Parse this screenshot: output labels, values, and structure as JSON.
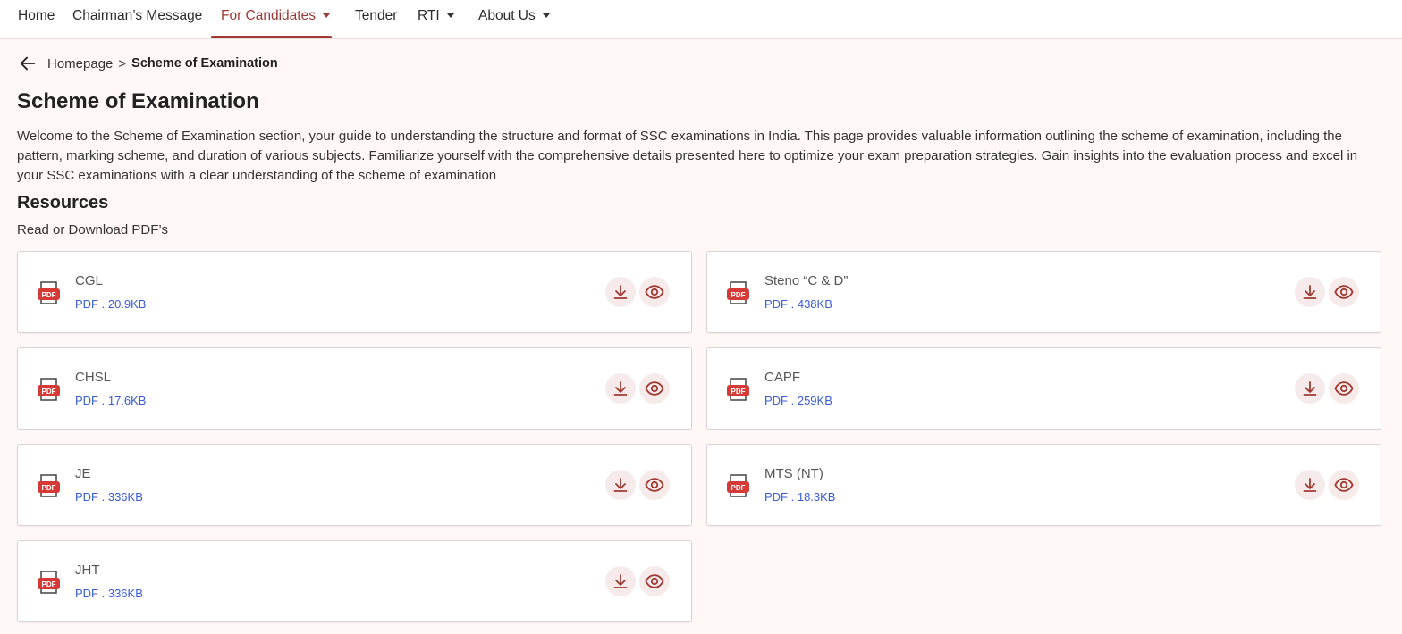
{
  "nav": {
    "items": [
      {
        "label": "Home",
        "dropdown": false,
        "active": false
      },
      {
        "label": "Chairman’s Message",
        "dropdown": false,
        "active": false
      },
      {
        "label": "For Candidates",
        "dropdown": true,
        "active": true
      },
      {
        "label": "Tender",
        "dropdown": false,
        "active": false
      },
      {
        "label": "RTI",
        "dropdown": true,
        "active": false
      },
      {
        "label": "About Us",
        "dropdown": true,
        "active": false
      }
    ]
  },
  "breadcrumb": {
    "back_icon": "arrow-left-icon",
    "home": "Homepage",
    "separator": ">",
    "current": "Scheme of Examination"
  },
  "page": {
    "title": "Scheme of Examination",
    "intro": "Welcome to the Scheme of Examination section, your guide to understanding the structure and format of SSC examinations in India. This page provides valuable information outlining the scheme of examination, including the pattern, marking scheme, and duration of various subjects. Familiarize yourself with the comprehensive details presented here to optimize your exam preparation strategies. Gain insights into the evaluation process and excel in your SSC examinations with a clear understanding of the scheme of examination"
  },
  "resources": {
    "title": "Resources",
    "subtitle": "Read or Download PDF’s",
    "files": [
      {
        "name": "CGL",
        "meta": "PDF . 20.9KB"
      },
      {
        "name": "Steno “C & D”",
        "meta": "PDF . 438KB"
      },
      {
        "name": "CHSL",
        "meta": "PDF . 17.6KB"
      },
      {
        "name": "CAPF",
        "meta": "PDF . 259KB"
      },
      {
        "name": "JE",
        "meta": "PDF . 336KB"
      },
      {
        "name": "MTS (NT)",
        "meta": "PDF . 18.3KB"
      },
      {
        "name": "JHT",
        "meta": "PDF . 336KB"
      }
    ]
  },
  "icons": {
    "file": "pdf-file-icon",
    "file_badge": "PDF",
    "download": "download-icon",
    "view": "eye-icon"
  },
  "colors": {
    "accent": "#9b3a34",
    "page_background": "#fff8f6",
    "link_blue": "#3a5bd4",
    "pdf_red": "#d63a36",
    "icon_button_bg": "#f6eaea"
  }
}
